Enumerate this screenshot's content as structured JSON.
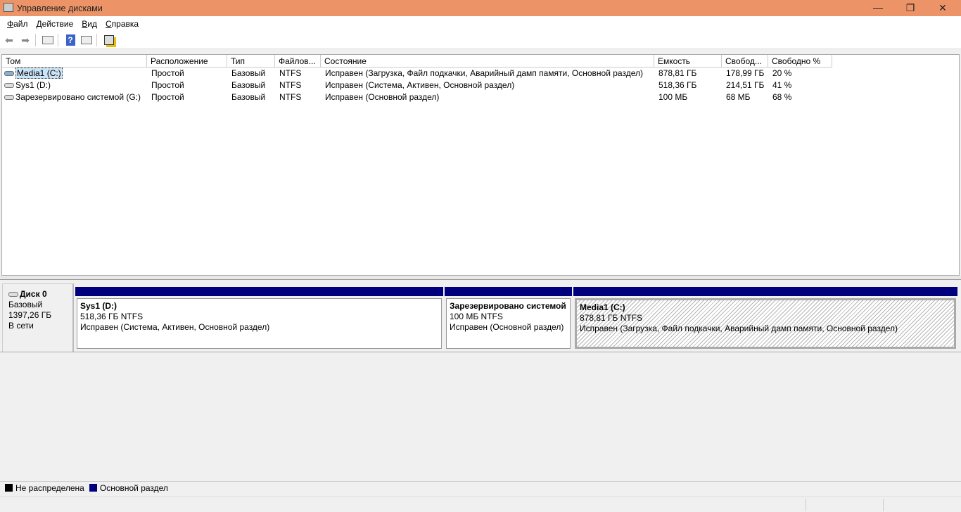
{
  "window": {
    "title": "Управление дисками",
    "minimize": "—",
    "maximize": "❐",
    "close": "✕"
  },
  "menu": [
    {
      "hot": "Ф",
      "rest": "айл"
    },
    {
      "hot": "Д",
      "rest": "ействие"
    },
    {
      "hot": "В",
      "rest": "ид"
    },
    {
      "hot": "С",
      "rest": "правка"
    }
  ],
  "toolbar": {
    "back": "back-icon",
    "forward": "forward-icon",
    "help": "?"
  },
  "columns": [
    "Том",
    "Расположение",
    "Тип",
    "Файлов...",
    "Состояние",
    "Емкость",
    "Свобод...",
    "Свободно %"
  ],
  "volumes": [
    [
      "Media1 (C:)",
      "Простой",
      "Базовый",
      "NTFS",
      "Исправен (Загрузка, Файл подкачки, Аварийный дамп памяти, Основной раздел)",
      "878,81 ГБ",
      "178,99 ГБ",
      "20 %"
    ],
    [
      "Sys1 (D:)",
      "Простой",
      "Базовый",
      "NTFS",
      "Исправен (Система, Активен, Основной раздел)",
      "518,36 ГБ",
      "214,51 ГБ",
      "41 %"
    ],
    [
      "Зарезервировано системой (G:)",
      "Простой",
      "Базовый",
      "NTFS",
      "Исправен (Основной раздел)",
      "100 МБ",
      "68 МБ",
      "68 %"
    ]
  ],
  "disk": {
    "name": "Диск 0",
    "type": "Базовый",
    "size": "1397,26 ГБ",
    "status": "В сети"
  },
  "partitions": [
    {
      "name": "Sys1  (D:)",
      "size": "518,36 ГБ NTFS",
      "status": "Исправен (Система, Активен, Основной раздел)"
    },
    {
      "name": "Зарезервировано системой",
      "size": "100 МБ NTFS",
      "status": "Исправен (Основной раздел)"
    },
    {
      "name": "Media1  (C:)",
      "size": "878,81 ГБ NTFS",
      "status": "Исправен (Загрузка, Файл подкачки, Аварийный дамп памяти, Основной раздел)"
    }
  ],
  "legend": [
    {
      "label": "Не распределена",
      "color": "#000000"
    },
    {
      "label": "Основной раздел",
      "color": "#00007f"
    }
  ]
}
